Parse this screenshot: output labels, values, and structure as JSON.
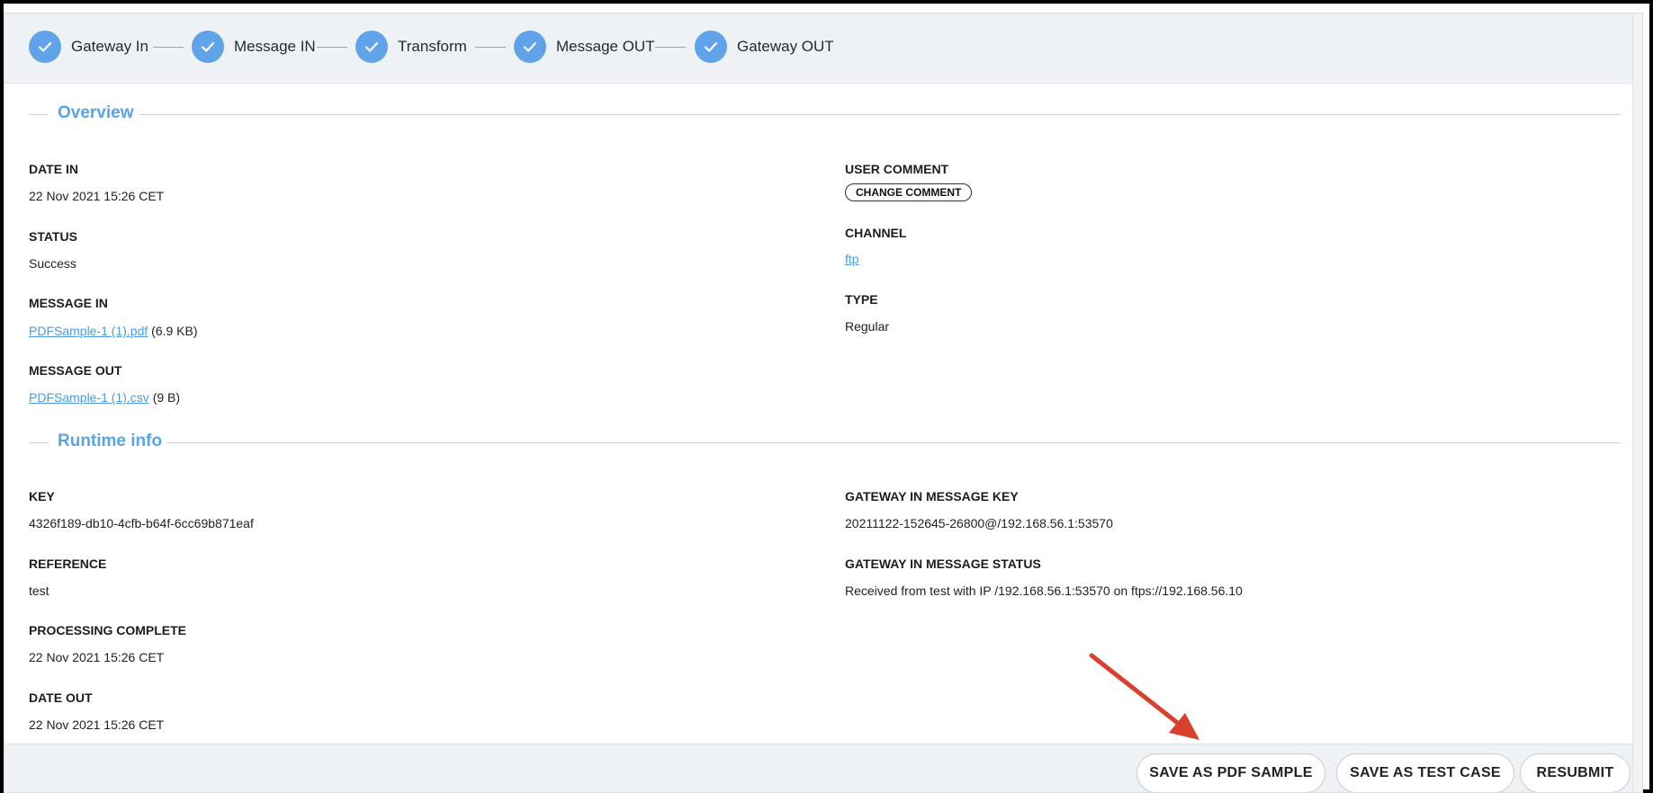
{
  "steps": [
    {
      "label": "Gateway In"
    },
    {
      "label": "Message IN"
    },
    {
      "label": "Transform"
    },
    {
      "label": "Message OUT"
    },
    {
      "label": "Gateway OUT"
    }
  ],
  "overview": {
    "title": "Overview",
    "date_in": {
      "label": "DATE IN",
      "value": "22 Nov 2021 15:26 CET"
    },
    "status": {
      "label": "STATUS",
      "value": "Success"
    },
    "message_in": {
      "label": "MESSAGE IN",
      "file": "PDFSample-1 (1).pdf",
      "size": "(6.9 KB)"
    },
    "message_out": {
      "label": "MESSAGE OUT",
      "file": "PDFSample-1 (1).csv",
      "size": "(9 B)"
    },
    "user_comment": {
      "label": "USER COMMENT",
      "button": "CHANGE COMMENT"
    },
    "channel": {
      "label": "CHANNEL",
      "value": "ftp"
    },
    "type": {
      "label": "TYPE",
      "value": "Regular"
    }
  },
  "runtime": {
    "title": "Runtime info",
    "key": {
      "label": "KEY",
      "value": "4326f189-db10-4cfb-b64f-6cc69b871eaf"
    },
    "reference": {
      "label": "REFERENCE",
      "value": "test"
    },
    "processing_complete": {
      "label": "PROCESSING COMPLETE",
      "value": "22 Nov 2021 15:26 CET"
    },
    "date_out": {
      "label": "DATE OUT",
      "value": "22 Nov 2021 15:26 CET"
    },
    "gateway_key": {
      "label": "GATEWAY IN MESSAGE KEY",
      "value": "20211122-152645-26800@/192.168.56.1:53570"
    },
    "gateway_status": {
      "label": "GATEWAY IN MESSAGE STATUS",
      "value": "Received from test with IP /192.168.56.1:53570 on ftps://192.168.56.10"
    }
  },
  "footer": {
    "save_pdf": "SAVE AS PDF SAMPLE",
    "save_test": "SAVE AS TEST CASE",
    "resubmit": "RESUBMIT"
  },
  "colors": {
    "accent": "#5aa3e6",
    "step_circle": "#60a3e8",
    "annotation_arrow": "#d9412f",
    "panel_bg": "#eef2f5"
  }
}
